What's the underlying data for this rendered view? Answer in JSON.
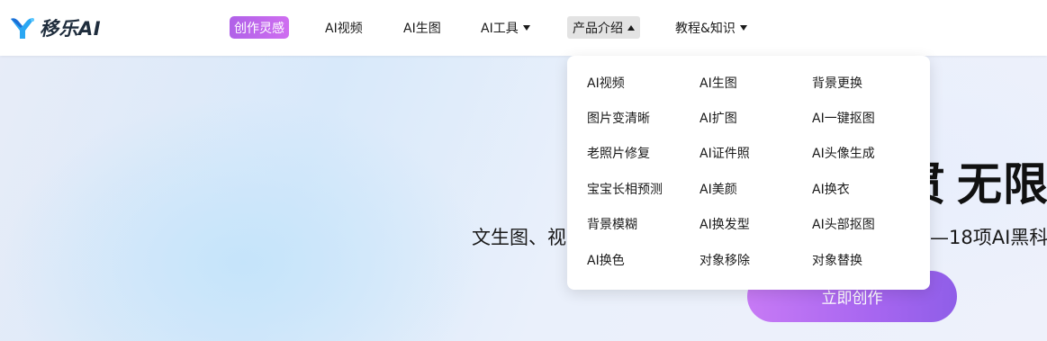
{
  "brand": {
    "name": "移乐AI"
  },
  "nav": {
    "inspire": "创作灵感",
    "video": "AI视频",
    "image_gen": "AI生图",
    "tools": "AI工具",
    "products": "产品介绍",
    "tutorials": "教程&知识"
  },
  "dropdown": {
    "items": [
      "AI视频",
      "AI生图",
      "背景更换",
      "图片变清晰",
      "AI扩图",
      "AI一键抠图",
      "老照片修复",
      "AI证件照",
      "AI头像生成",
      "宝宝长相预测",
      "AI美颜",
      "AI换衣",
      "背景模糊",
      "AI换发型",
      "AI头部抠图",
      "AI换色",
      "对象移除",
      "对象替换"
    ]
  },
  "hero": {
    "title_visible": "无限",
    "subtitle_left": "文生图、视",
    "subtitle_right": "——18项AI黑科",
    "cta": "立即创作"
  },
  "colors": {
    "accent_purple": "#a766f0",
    "inspire_badge": "#b061e8",
    "logo_blue": "#2aa7f3"
  }
}
